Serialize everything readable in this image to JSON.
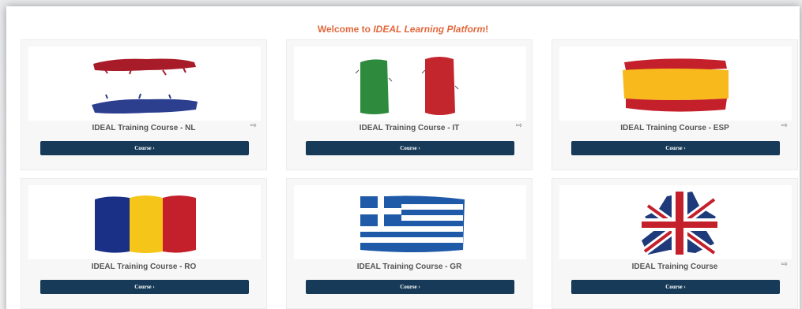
{
  "header": {
    "welcome_prefix": "Welcome to ",
    "welcome_platform": "IDEAL Learning Platform",
    "welcome_suffix": "!"
  },
  "colors": {
    "accent": "#e2683c",
    "button": "#163a58"
  },
  "courses": [
    {
      "title": "IDEAL Training Course - NL",
      "button": "Course ›",
      "flag": "netherlands-flag",
      "exit_icon": "enter-icon"
    },
    {
      "title": "IDEAL Training Course - IT",
      "button": "Course ›",
      "flag": "italy-flag",
      "exit_icon": "enter-icon"
    },
    {
      "title": "IDEAL Training Course - ESP",
      "button": "Course ›",
      "flag": "spain-flag",
      "exit_icon": "enter-icon"
    },
    {
      "title": "IDEAL Training Course - RO",
      "button": "Course ›",
      "flag": "romania-flag"
    },
    {
      "title": "IDEAL Training Course - GR",
      "button": "Course ›",
      "flag": "greece-flag"
    },
    {
      "title": "IDEAL Training Course",
      "button": "Course ›",
      "flag": "uk-flag",
      "exit_icon": "enter-icon"
    }
  ]
}
